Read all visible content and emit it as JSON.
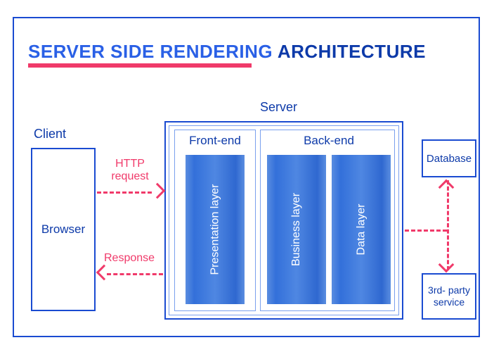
{
  "title": {
    "accent_part": "SERVER SIDE RENDERING",
    "rest_part": " ARCHITECTURE"
  },
  "client": {
    "heading": "Client",
    "box_label": "Browser"
  },
  "server": {
    "heading": "Server",
    "frontend_label": "Front-end",
    "backend_label": "Back-end",
    "layers": {
      "presentation": "Presentation layer",
      "business": "Business layer",
      "data": "Data layer"
    }
  },
  "side_boxes": {
    "database": "Database",
    "third_party": "3rd- party service"
  },
  "arrows": {
    "request_label": "HTTP request",
    "response_label": "Response"
  },
  "colors": {
    "outline": "#1a4bd1",
    "text": "#0d3aa9",
    "accent": "#f03a6a",
    "layer_fill": "#3a74d8"
  }
}
